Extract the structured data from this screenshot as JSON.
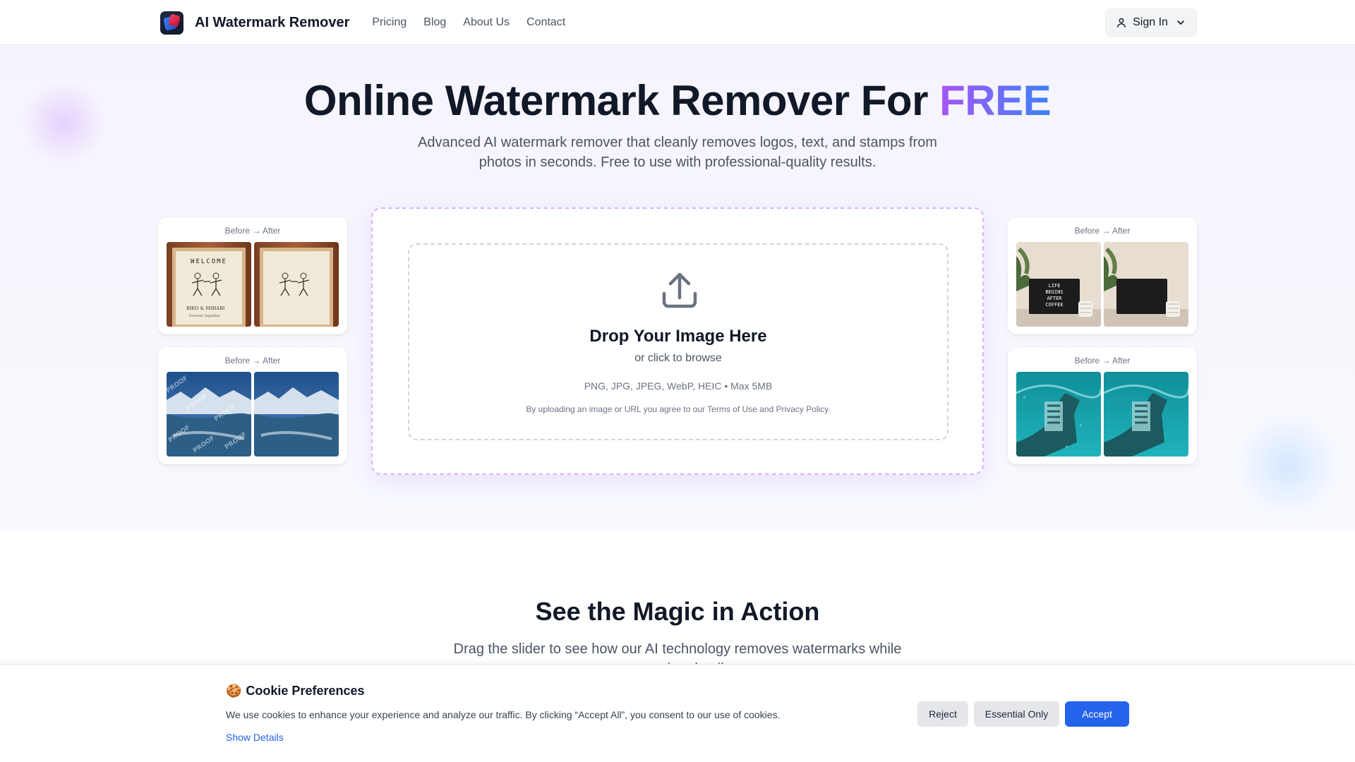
{
  "header": {
    "brand": "AI Watermark Remover",
    "nav": [
      "Pricing",
      "Blog",
      "About Us",
      "Contact"
    ],
    "sign_in": "Sign In"
  },
  "hero": {
    "title_main": "Online Watermark Remover For ",
    "title_accent": "FREE",
    "subtitle": "Advanced AI watermark remover that cleanly removes logos, text, and stamps from photos in seconds. Free to use with professional-quality results.",
    "accent_gradient": [
      "#a855f7",
      "#3b82f6"
    ]
  },
  "examples": {
    "caption": "Before → After",
    "items": [
      {
        "subject": "welcome-sign-frame",
        "watermark_text": "WELCOME"
      },
      {
        "subject": "aerial-mountains",
        "watermark_text": "PROOF"
      },
      {
        "subject": "coffee-letterboard",
        "watermark_text": "LIFE BEGINS AFTER COFFEE"
      },
      {
        "subject": "underwater-building",
        "watermark_text": ""
      }
    ]
  },
  "upload": {
    "title": "Drop Your Image Here",
    "subtitle": "or click to browse",
    "formats": "PNG, JPG, JPEG, WebP, HEIC • Max 5MB",
    "legal": "By uploading an image or URL you agree to our Terms of Use and Privacy Policy."
  },
  "magic": {
    "title": "See the Magic in Action",
    "subtitle": "Drag the slider to see how our AI technology removes watermarks while preserving details."
  },
  "cookie": {
    "emoji": "🍪",
    "title": "Cookie Preferences",
    "text": "We use cookies to enhance your experience and analyze our traffic. By clicking “Accept All”, you consent to our use of cookies.",
    "details_link": "Show Details",
    "buttons": {
      "reject": "Reject",
      "essential": "Essential Only",
      "accept": "Accept"
    },
    "accept_color": "#2563eb"
  }
}
